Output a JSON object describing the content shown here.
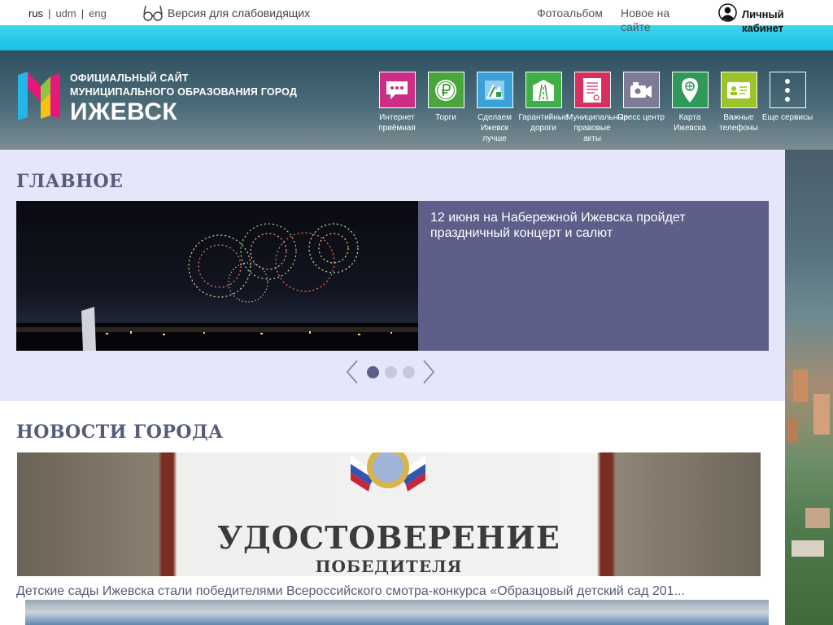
{
  "topbar": {
    "languages": [
      {
        "code": "rus",
        "active": true
      },
      {
        "code": "udm",
        "active": false
      },
      {
        "code": "eng",
        "active": false
      }
    ],
    "vision_label": "Версия для слабовидящих",
    "photoalbum": "Фотоальбом",
    "new_on_site": "Новое на сайте",
    "cabinet": "Личный кабинет"
  },
  "header": {
    "logo_line1": "Официальный сайт",
    "logo_line2": "муниципального образования город",
    "logo_city": "ИЖЕВСК"
  },
  "services": [
    {
      "label": "Интернет приёмная",
      "icon": "chat-icon",
      "color": "#cc2e86"
    },
    {
      "label": "Торги",
      "icon": "ruble-icon",
      "color": "#4aa63c"
    },
    {
      "label": "Сделаем Ижевск лучше",
      "icon": "city-improve-icon",
      "color": "#3aa0d8"
    },
    {
      "label": "Гарантийные дороги",
      "icon": "road-icon",
      "color": "#3fb046"
    },
    {
      "label": "Муниципальные правовые акты",
      "icon": "document-icon",
      "color": "#d92f5e"
    },
    {
      "label": "Пресс центр",
      "icon": "camera-icon",
      "color": "#7e7b96"
    },
    {
      "label": "Карта Ижевска",
      "icon": "map-pin-icon",
      "color": "#2f9a58"
    },
    {
      "label": "Важные телефоны",
      "icon": "contact-card-icon",
      "color": "#9cc42a"
    },
    {
      "label": "Еще сервисы",
      "icon": "more-icon",
      "color": "transparent"
    }
  ],
  "main": {
    "title": "ГЛАВНОЕ",
    "slide_caption": "12 июня на Набережной Ижевска пройдет праздничный концерт и салют",
    "slides_count": 3,
    "active_slide": 1
  },
  "news": {
    "title": "НОВОСТИ ГОРОДА",
    "cert_title": "УДОСТОВЕРЕНИЕ",
    "cert_subtitle": "ПОБЕДИТЕЛЯ",
    "caption": "Детские сады Ижевска стали победителями Всероссийского смотра-конкурса «Образцовый детский сад 201..."
  }
}
